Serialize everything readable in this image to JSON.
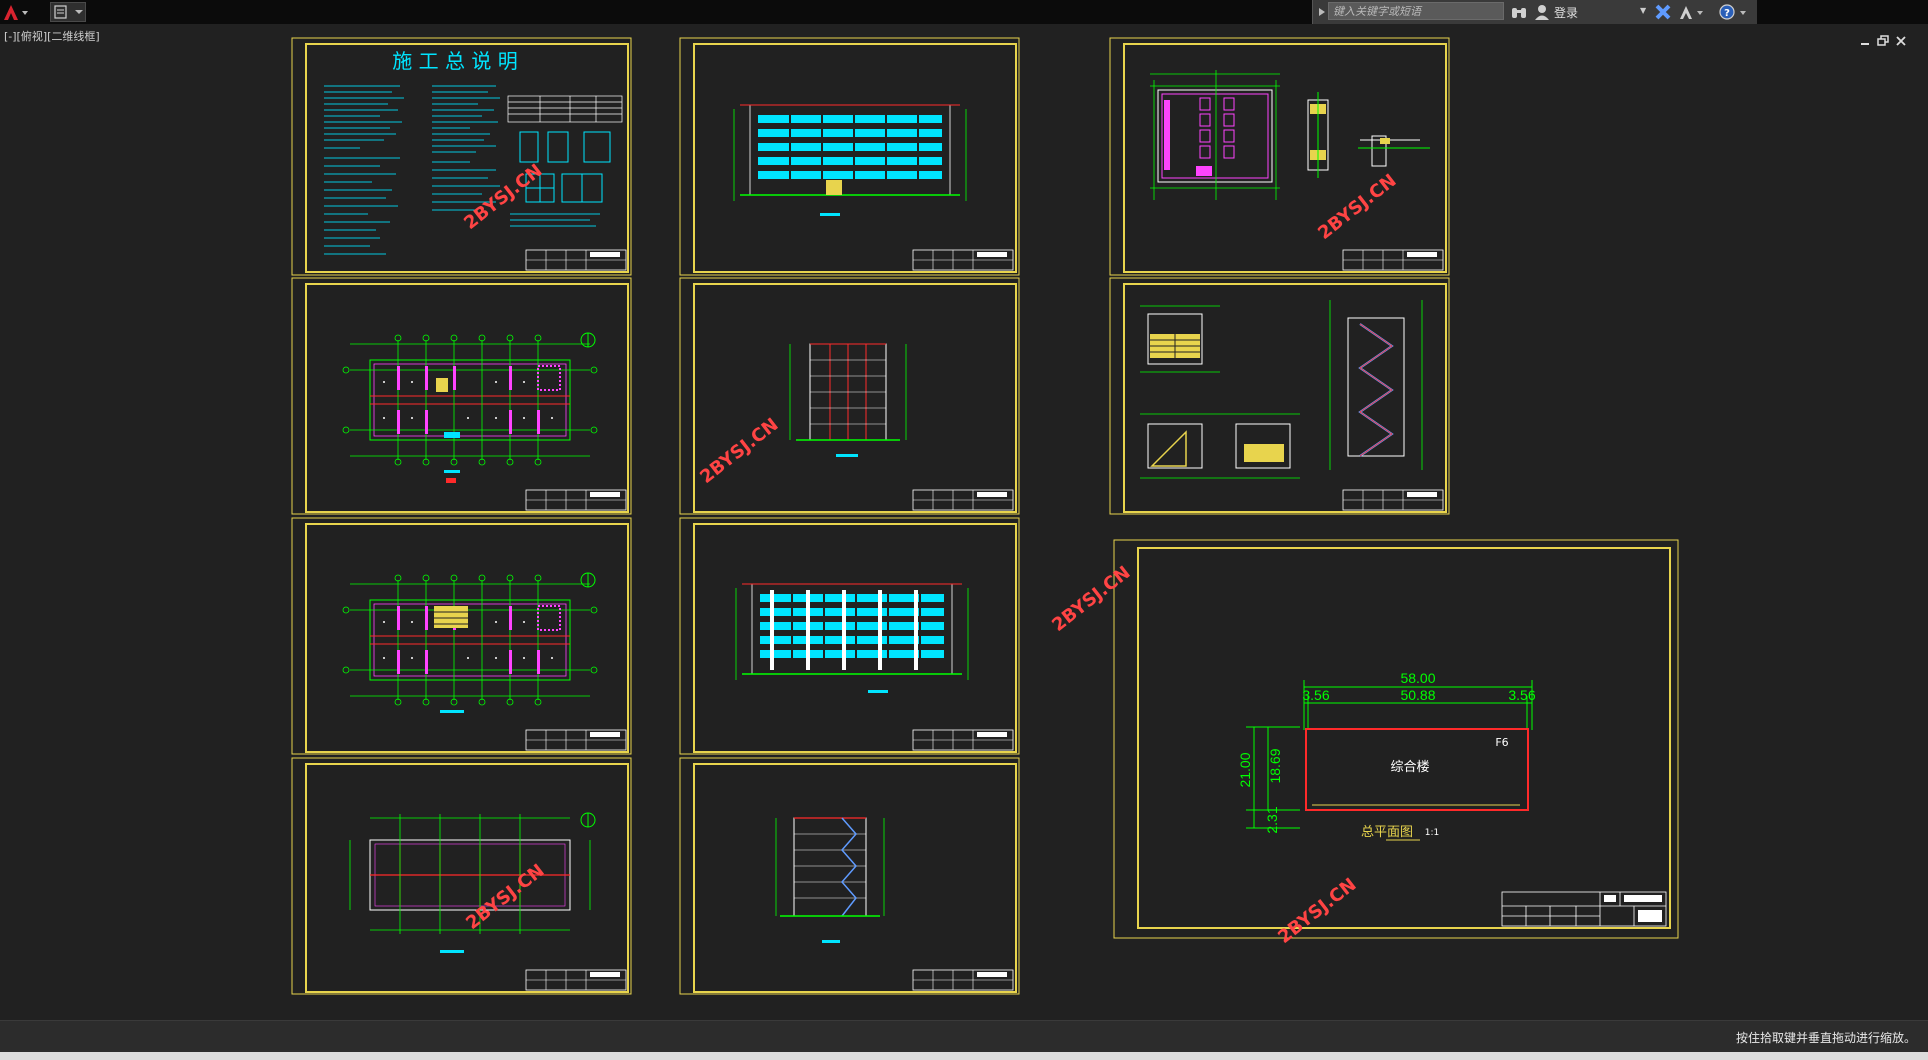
{
  "title_bar": {
    "search": {
      "placeholder": "键入关键字或短语"
    },
    "login_label": "登录"
  },
  "viewport": {
    "label": "[-][俯视][二维线框]"
  },
  "drawing": {
    "sheet1_title": "施 工 总 说 明",
    "site_plan": {
      "total_width": "58.00",
      "inner_width": "50.88",
      "left_offset": "3.56",
      "right_offset": "3.56",
      "total_depth": "21.00",
      "inner_depth": "18.69",
      "bottom_offset": "2.31",
      "building_name": "综合楼",
      "floors": "F6",
      "caption": "总平面图",
      "scale": "1:1"
    },
    "watermark": "2BYSJ.CN"
  },
  "status_bar": {
    "message": "按住拾取键并垂直拖动进行缩放。"
  },
  "colors": {
    "background": "#212121",
    "sheet_border": "#e8d44d",
    "linework": "#00ff00",
    "accent": "#00e5ff",
    "wall": "#ff2a2a",
    "magenta": "#ff44ff",
    "watermark": "#ff4444"
  }
}
